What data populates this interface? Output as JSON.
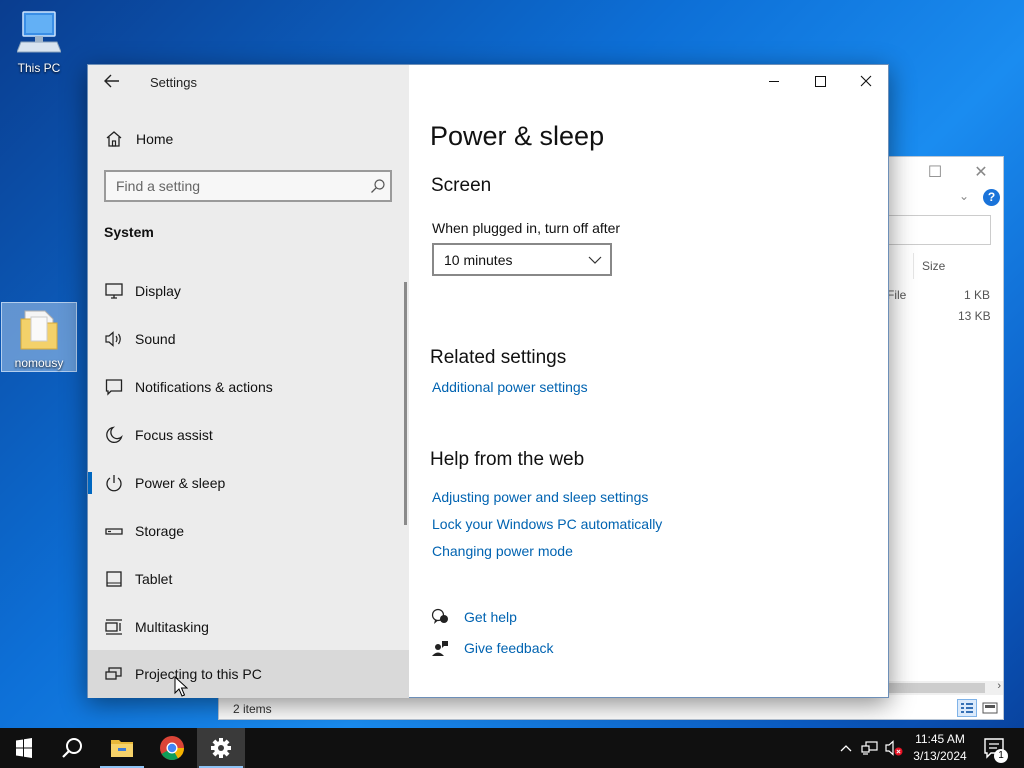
{
  "desktop": {
    "icons": [
      {
        "label": "This PC"
      },
      {
        "label": "nomousy"
      }
    ]
  },
  "explorer": {
    "size_header": "Size",
    "rows": [
      {
        "type": "File",
        "size": "1 KB"
      },
      {
        "type": "",
        "size": "13 KB"
      }
    ],
    "status": "2 items",
    "help_label": "?"
  },
  "settings": {
    "app_title": "Settings",
    "home_label": "Home",
    "search": {
      "placeholder": "Find a setting"
    },
    "section_label": "System",
    "nav_items": [
      {
        "label": "Display",
        "icon": "monitor-icon"
      },
      {
        "label": "Sound",
        "icon": "speaker-icon"
      },
      {
        "label": "Notifications & actions",
        "icon": "notification-icon"
      },
      {
        "label": "Focus assist",
        "icon": "moon-icon"
      },
      {
        "label": "Power & sleep",
        "icon": "power-icon",
        "active": true
      },
      {
        "label": "Storage",
        "icon": "storage-icon"
      },
      {
        "label": "Tablet",
        "icon": "tablet-icon"
      },
      {
        "label": "Multitasking",
        "icon": "multitasking-icon"
      },
      {
        "label": "Projecting to this PC",
        "icon": "projecting-icon"
      }
    ],
    "page_title": "Power & sleep",
    "screen": {
      "heading": "Screen",
      "plugged_label": "When plugged in, turn off after",
      "timeout_value": "10 minutes"
    },
    "related": {
      "heading": "Related settings",
      "additional_link": "Additional power settings"
    },
    "help_web": {
      "heading": "Help from the web",
      "links": [
        "Adjusting power and sleep settings",
        "Lock your Windows PC automatically",
        "Changing power mode"
      ]
    },
    "get_help": "Get help",
    "give_feedback": "Give feedback"
  },
  "taskbar": {
    "time": "11:45 AM",
    "date": "3/13/2024",
    "notification_count": "1"
  },
  "colors": {
    "accent": "#0067c0",
    "link": "#0063b1",
    "sidebar_bg": "#ececec",
    "taskbar_bg": "#101010"
  }
}
